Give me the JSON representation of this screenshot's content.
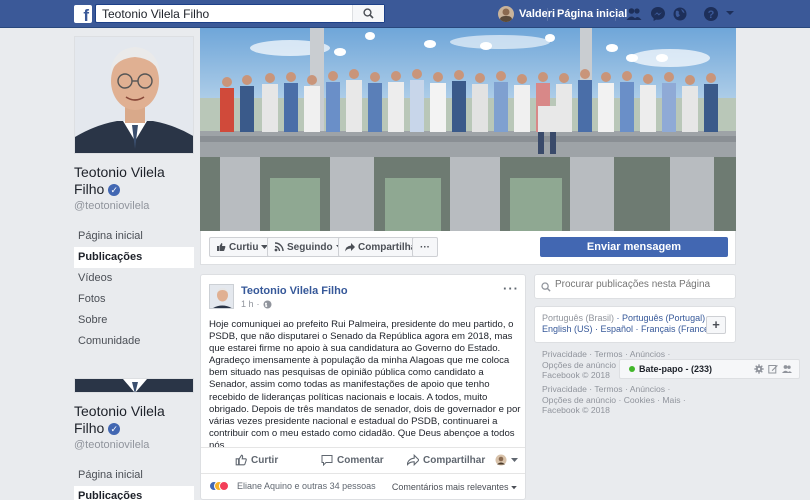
{
  "topbar": {
    "logo": "f",
    "search_value": "Teotonio Vilela Filho",
    "user_name": "Valderi",
    "home_label": "Página inicial"
  },
  "profile": {
    "name_line1": "Teotonio Vilela",
    "name_line2": "Filho",
    "handle": "@teotoniovilela",
    "nav": [
      "Página inicial",
      "Publicações",
      "Vídeos",
      "Fotos",
      "Sobre",
      "Comunidade"
    ],
    "active_nav": "Publicações"
  },
  "profile_repeat": {
    "name_line1": "Teotonio Vilela",
    "name_line2": "Filho",
    "handle": "@teotoniovilela",
    "nav": [
      "Página inicial",
      "Publicações"
    ]
  },
  "actions": {
    "like": "Curtiu",
    "follow": "Seguindo",
    "share": "Compartilhar",
    "more": "···",
    "send_message": "Enviar mensagem"
  },
  "post": {
    "author": "Teotonio Vilela Filho",
    "time": "1 h",
    "more": "···",
    "text": "Hoje comuniquei ao prefeito Rui Palmeira, presidente do meu partido, o PSDB, que não disputarei o Senado da República agora em 2018, mas que estarei firme no apoio à sua candidatura ao Governo do Estado. Agradeço imensamente à população da minha Alagoas que me coloca bem situado nas pesquisas de opinião pública como candidato a Senador, assim como todas as manifestações de apoio que tenho recebido de lideranças políticas nacionais e locais. A todos, muito obrigado. Depois de três mandatos de senador, dois de governador e por várias vezes presidente nacional e estadual do PSDB, continuarei a contribuir com o meu estado como cidadão. Que Deus abençoe a todos nós.",
    "like_label": "Curtir",
    "comment_label": "Comentar",
    "share_label": "Compartilhar",
    "reactions_text": "Eliane Aquino e outras 34 pessoas",
    "comments_sort": "Comentários mais relevantes"
  },
  "sidebar": {
    "search_placeholder": "Procurar publicações nesta Página",
    "lang_current": "Português (Brasil)",
    "lang_options": [
      "Português (Portugal)",
      "English (US)",
      "Español",
      "Français (France)"
    ],
    "lang_add": "+",
    "footer1_line1": "Privacidade · Termos · Anúncios ·",
    "footer1_line2": "Opções de anúncio ·",
    "footer1_line3": "Facebook © 2018",
    "footer2_line1": "Privacidade · Termos · Anúncios ·",
    "footer2_line2": "Opções de anúncio · Cookies · Mais ·",
    "footer2_line3": "Facebook © 2018"
  },
  "chat": {
    "label": "Bate-papo",
    "count": "(233)"
  },
  "colors": {
    "brand": "#3b5998",
    "link": "#365899",
    "button": "#4267b2",
    "online": "#42b72a"
  }
}
